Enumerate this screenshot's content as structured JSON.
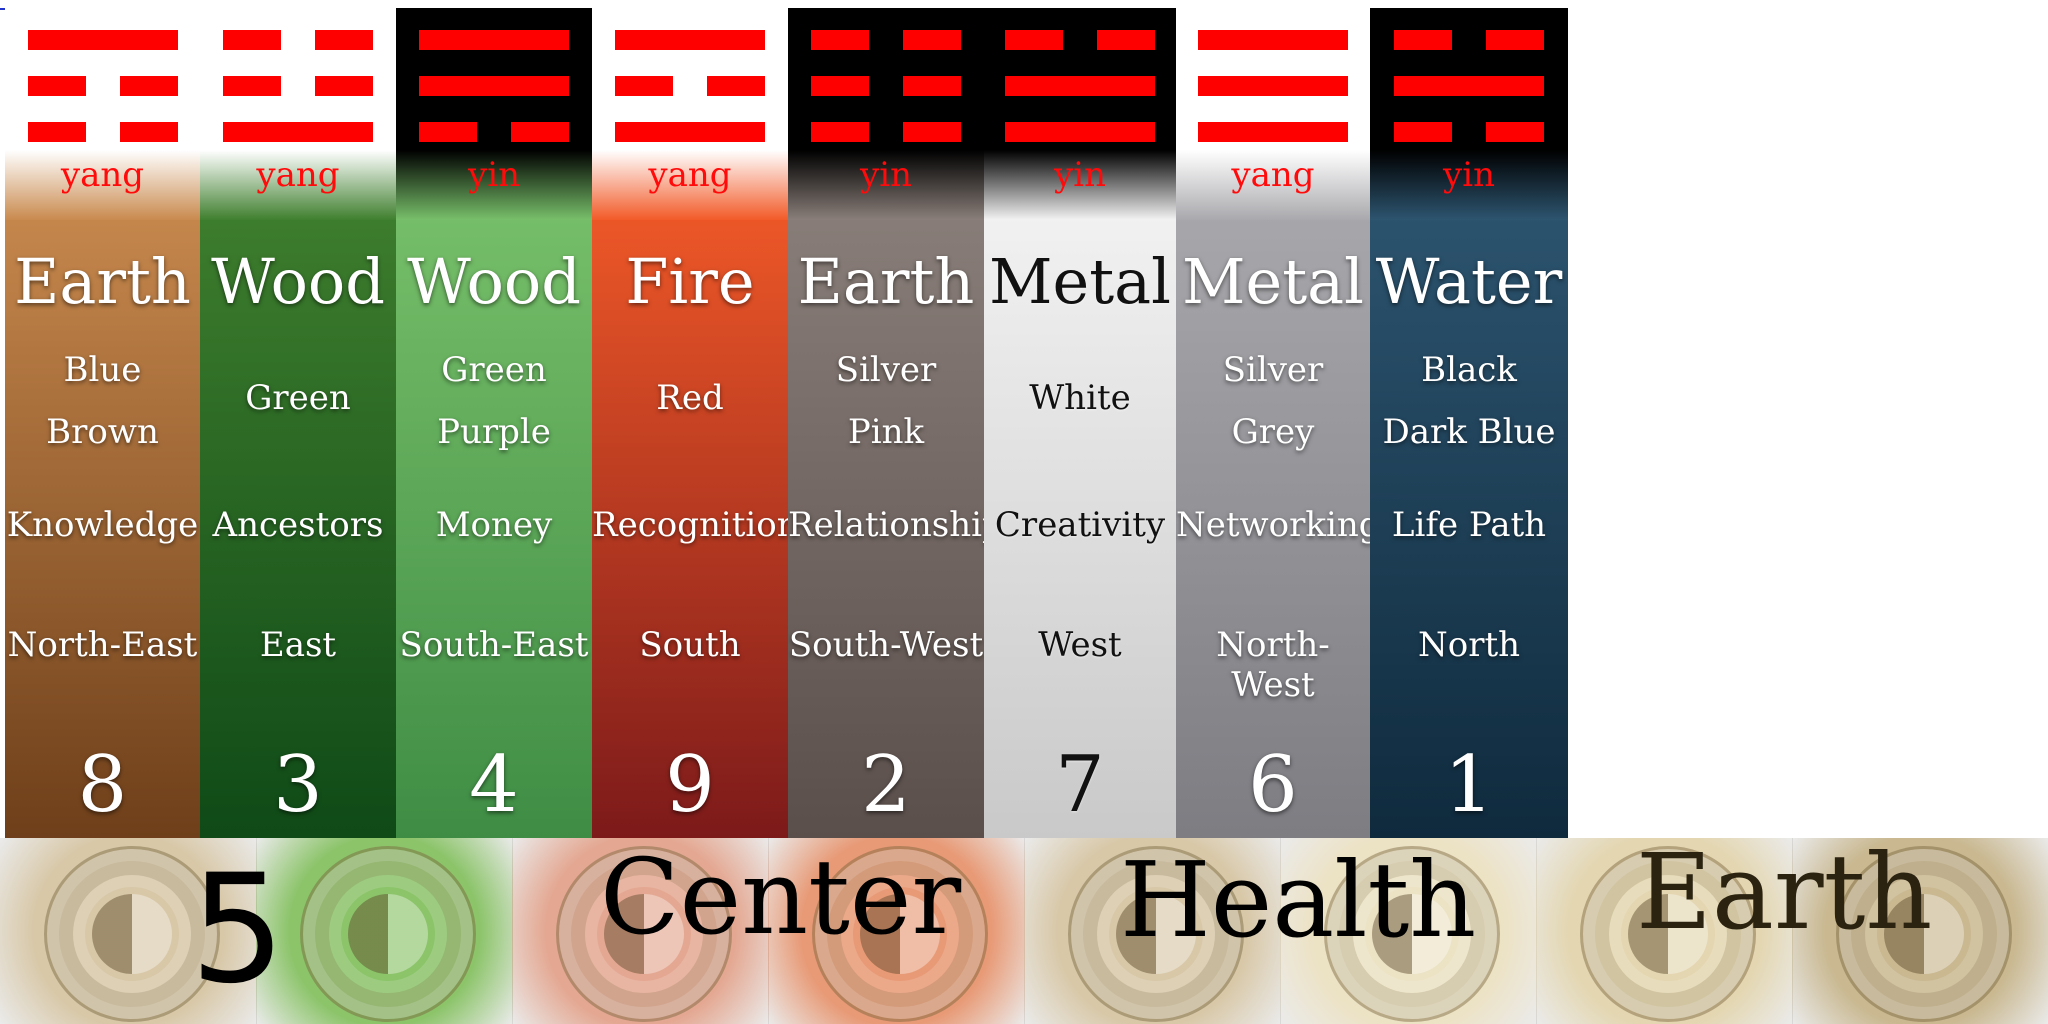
{
  "columns": [
    {
      "polarity": "yang",
      "element": "Earth",
      "colors": [
        "Blue",
        "Brown"
      ],
      "aspiration": "Knowledge",
      "direction": "North-East",
      "number": "8",
      "trigram": "mountain",
      "head_bg": "#ffffff",
      "bg": [
        "#c98a4e",
        "#6e3f1a"
      ],
      "text_theme": "light"
    },
    {
      "polarity": "yang",
      "element": "Wood",
      "colors": [
        "Green"
      ],
      "aspiration": "Ancestors",
      "direction": "East",
      "number": "3",
      "trigram": "thunder",
      "head_bg": "#ffffff",
      "bg": [
        "#3f7f2e",
        "#0f4a17"
      ],
      "text_theme": "light"
    },
    {
      "polarity": "yin",
      "element": "Wood",
      "colors": [
        "Green",
        "Purple"
      ],
      "aspiration": "Money",
      "direction": "South-East",
      "number": "4",
      "trigram": "wind",
      "head_bg": "#000000",
      "bg": [
        "#78c06a",
        "#3f8d45"
      ],
      "text_theme": "light"
    },
    {
      "polarity": "yang",
      "element": "Fire",
      "colors": [
        "Red"
      ],
      "aspiration": "Recognition",
      "direction": "South",
      "number": "9",
      "trigram": "fire",
      "head_bg": "#ffffff",
      "bg": [
        "#f25a28",
        "#7c1a1a"
      ],
      "text_theme": "light"
    },
    {
      "polarity": "yin",
      "element": "Earth",
      "colors": [
        "Silver",
        "Pink"
      ],
      "aspiration": "Relationships",
      "direction": "South-West",
      "number": "2",
      "trigram": "earth",
      "head_bg": "#000000",
      "bg": [
        "#8a7f7a",
        "#5b4f4b"
      ],
      "text_theme": "light"
    },
    {
      "polarity": "yin",
      "element": "Metal",
      "colors": [
        "White"
      ],
      "aspiration": "Creativity",
      "direction": "West",
      "number": "7",
      "trigram": "lake",
      "head_bg": "#000000",
      "bg": [
        "#f3f3f3",
        "#c9c9c9"
      ],
      "text_theme": "dark"
    },
    {
      "polarity": "yang",
      "element": "Metal",
      "colors": [
        "Silver",
        "Grey"
      ],
      "aspiration": "Networking",
      "direction": "North-West",
      "number": "6",
      "trigram": "heaven",
      "head_bg": "#ffffff",
      "bg": [
        "#a9a9ad",
        "#7d7d82"
      ],
      "text_theme": "light"
    },
    {
      "polarity": "yin",
      "element": "Water",
      "colors": [
        "Black",
        "Dark Blue"
      ],
      "aspiration": "Life Path",
      "direction": "North",
      "number": "1",
      "trigram": "water",
      "head_bg": "#000000",
      "bg": [
        "#2d5570",
        "#0f2a3d"
      ],
      "text_theme": "light"
    }
  ],
  "bottom": {
    "number": "5",
    "aspiration": "Health",
    "direction": "Center",
    "element": "Earth",
    "tile_tints": [
      "#d8c8a8",
      "#8cc46a",
      "#e4a892",
      "#e89a76",
      "#d8c8a8",
      "#ece2c4",
      "#e3d6b0",
      "#c9b890"
    ]
  },
  "accent": "#ff0000"
}
